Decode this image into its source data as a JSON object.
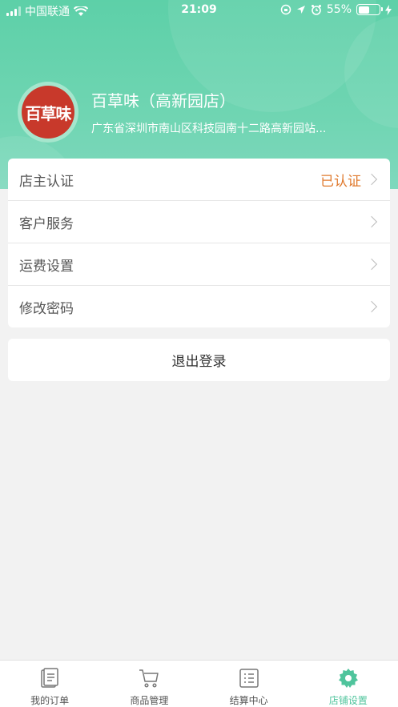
{
  "status_bar": {
    "carrier": "中国联通",
    "time": "21:09",
    "battery_percent": "55%",
    "battery_level": 0.55
  },
  "store": {
    "logo_text": "百草味",
    "name": "百草味（高新园店）",
    "address": "广东省深圳市南山区科技园南十二路高新园站..."
  },
  "menu": {
    "items": [
      {
        "label": "店主认证",
        "value": "已认证"
      },
      {
        "label": "客户服务",
        "value": ""
      },
      {
        "label": "运费设置",
        "value": ""
      },
      {
        "label": "修改密码",
        "value": ""
      }
    ]
  },
  "logout_label": "退出登录",
  "tabs": [
    {
      "label": "我的订单",
      "icon": "orders-icon"
    },
    {
      "label": "商品管理",
      "icon": "cart-icon"
    },
    {
      "label": "结算中心",
      "icon": "settlement-icon"
    },
    {
      "label": "店铺设置",
      "icon": "gear-icon"
    }
  ],
  "colors": {
    "accent": "#4fc49c",
    "header_gradient_top": "#5dd0a8",
    "verified": "#e07a2e",
    "logo_bg": "#c8392b"
  }
}
